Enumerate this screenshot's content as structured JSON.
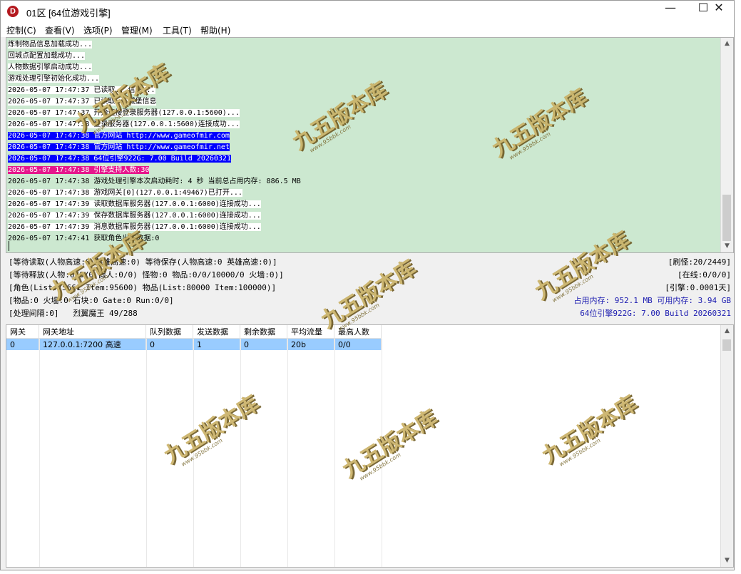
{
  "window": {
    "title": "01区 [64位游戏引擎]",
    "icon_letter": "D",
    "minimize_glyph": "—",
    "maximize_glyph": "☐",
    "close_glyph": "✕"
  },
  "menu": [
    "控制(C)",
    "查看(V)",
    "选项(P)",
    "管理(M)",
    "工具(T)",
    "帮助(H)"
  ],
  "log": [
    {
      "text": "炼制物品信息加载成功...",
      "style": "normal"
    },
    {
      "text": "回城点配置加载成功...",
      "style": "normal"
    },
    {
      "text": "人物数据引擎启动成功...",
      "style": "normal"
    },
    {
      "text": "游戏处理引擎初始化成功...",
      "style": "normal"
    },
    {
      "text": "2026-05-07 17:47:37 已读取...信息...",
      "style": "normal"
    },
    {
      "text": "2026-05-07 17:47:37 已读取...城堡信息",
      "style": "normal"
    },
    {
      "text": "2026-05-07 17:47:37 开始连接登录服务器(127.0.0.1:5600)...",
      "style": "normal"
    },
    {
      "text": "2026-05-07 17:47:38 登录服务器(127.0.0.1:5600)连接成功...",
      "style": "normal"
    },
    {
      "text": "2026-05-07 17:47:38 官方网站 http://www.gameofmir.com",
      "style": "blue"
    },
    {
      "text": "2026-05-07 17:47:38 官方网站 http://www.gameofmir.net",
      "style": "blue"
    },
    {
      "text": "2026-05-07 17:47:38 64位引擎922G: 7.00 Build 20260321",
      "style": "blue"
    },
    {
      "text": "2026-05-07 17:47:38 引擎支持人数:30",
      "style": "pink"
    },
    {
      "text": "2026-05-07 17:47:38 游戏处理引擎本次启动耗时: 4 秒 当前总占用内存: 886.5 MB",
      "style": "plain"
    },
    {
      "text": "2026-05-07 17:47:38 游戏网关[0](127.0.0.1:49467)已打开...",
      "style": "normal"
    },
    {
      "text": "2026-05-07 17:47:39 读取数据库服务器(127.0.0.1:6000)连接成功...",
      "style": "normal"
    },
    {
      "text": "2026-05-07 17:47:39 保存数据库服务器(127.0.0.1:6000)连接成功...",
      "style": "normal"
    },
    {
      "text": "2026-05-07 17:47:39 消息数据库服务器(127.0.0.1:6000)连接成功...",
      "style": "normal"
    },
    {
      "text": "2026-05-07 17:47:41 获取角色出售数据:0",
      "style": "plain"
    }
  ],
  "status": {
    "left": [
      "[等待读取(人物高速:0 英雄高速:0) 等待保存(人物高速:0 英雄高速:0)]",
      "[等待释放(人物:0/0/0 假人:0/0) 怪物:0 物品:0/0/10000/0 火墙:0)]",
      "[角色(List:75661 Item:95600) 物品(List:80000 Item:100000)]",
      "[物品:0 火墙:0 石块:0 Gate:0 Run:0/0]",
      "[处理间隔:0]   烈翼魔王 49/288"
    ],
    "right": [
      "[刷怪:20/2449]",
      "[在线:0/0/0]",
      "[引擎:0.0001天]",
      "占用内存: 952.1 MB 可用内存: 3.94 GB",
      "64位引擎922G: 7.00 Build 20260321"
    ]
  },
  "gateway_table": {
    "headers": [
      "网关",
      "网关地址",
      "队列数据",
      "发送数据",
      "剩余数据",
      "平均流量",
      "最高人数"
    ],
    "rows": [
      [
        "0",
        "127.0.0.1:7200 高速",
        "0",
        "1",
        "0",
        "20b",
        "0/0"
      ]
    ]
  },
  "watermark": {
    "text": "九五版本库",
    "url": "www.95bbk.com",
    "color": "#c9b064"
  },
  "scroll_arrows": {
    "up": "▲",
    "down": "▼"
  }
}
